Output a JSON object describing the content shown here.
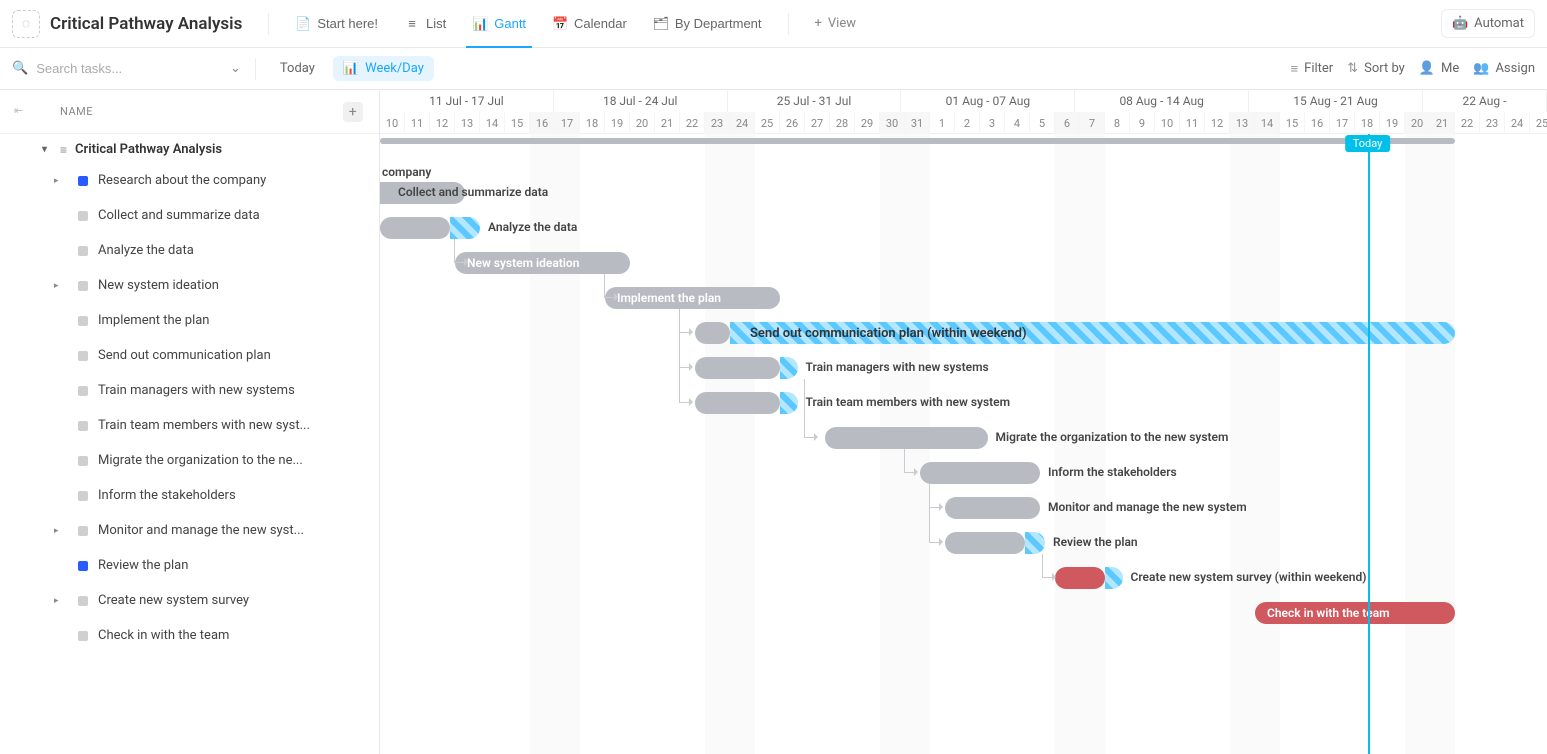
{
  "header": {
    "title": "Critical Pathway Analysis",
    "views": [
      {
        "label": "Start here!",
        "icon": "note-icon"
      },
      {
        "label": "List",
        "icon": "list-icon"
      },
      {
        "label": "Gantt",
        "icon": "gantt-icon",
        "active": true
      },
      {
        "label": "Calendar",
        "icon": "calendar-icon"
      },
      {
        "label": "By Department",
        "icon": "dept-icon"
      }
    ],
    "add_view_label": "View",
    "automate_label": "Automat"
  },
  "toolbar": {
    "search_placeholder": "Search tasks...",
    "today_label": "Today",
    "zoom_label": "Week/Day",
    "filter_label": "Filter",
    "sort_label": "Sort by",
    "me_label": "Me",
    "assign_label": "Assign"
  },
  "sidebar": {
    "column_header": "NAME",
    "group_title": "Critical Pathway Analysis",
    "tasks": [
      {
        "label": "Research about the company",
        "status": "blue",
        "has_children": true
      },
      {
        "label": "Collect and summarize data",
        "status": "grey"
      },
      {
        "label": "Analyze the data",
        "status": "grey"
      },
      {
        "label": "New system ideation",
        "status": "grey",
        "has_children": true
      },
      {
        "label": "Implement the plan",
        "status": "grey"
      },
      {
        "label": "Send out communication plan",
        "status": "grey"
      },
      {
        "label": "Train managers with new systems",
        "status": "grey"
      },
      {
        "label": "Train team members with new syst...",
        "status": "grey"
      },
      {
        "label": "Migrate the organization to the ne...",
        "status": "grey"
      },
      {
        "label": "Inform the stakeholders",
        "status": "grey"
      },
      {
        "label": "Monitor and manage the new syst...",
        "status": "grey",
        "has_children": true
      },
      {
        "label": "Review the plan",
        "status": "blue"
      },
      {
        "label": "Create new system survey",
        "status": "grey",
        "has_children": true
      },
      {
        "label": "Check in with the team",
        "status": "grey"
      }
    ]
  },
  "gantt": {
    "today_label": "Today",
    "today_day_index": 39,
    "day_width": 25,
    "weeks": [
      {
        "label": "11 Jul - 17 Jul",
        "days": 7
      },
      {
        "label": "18 Jul - 24 Jul",
        "days": 7
      },
      {
        "label": "25 Jul - 31 Jul",
        "days": 7
      },
      {
        "label": "01 Aug - 07 Aug",
        "days": 7
      },
      {
        "label": "08 Aug - 14 Aug",
        "days": 7
      },
      {
        "label": "15 Aug - 21 Aug",
        "days": 7
      },
      {
        "label": "22 Aug -",
        "days": 5
      }
    ],
    "days": [
      "10",
      "11",
      "12",
      "13",
      "14",
      "15",
      "16",
      "17",
      "18",
      "19",
      "20",
      "21",
      "22",
      "23",
      "24",
      "25",
      "26",
      "27",
      "28",
      "29",
      "30",
      "31",
      "1",
      "2",
      "3",
      "4",
      "5",
      "6",
      "7",
      "8",
      "9",
      "10",
      "11",
      "12",
      "13",
      "14",
      "15",
      "16",
      "17",
      "18",
      "19",
      "20",
      "21",
      "22",
      "23",
      "24",
      "25"
    ],
    "shaded_days": [
      6,
      7,
      13,
      14,
      20,
      21,
      27,
      28,
      34,
      35,
      41,
      42
    ],
    "summary_start": 0,
    "summary_end": 43,
    "first_row_label": "company",
    "bars": [
      {
        "row": 1,
        "start": -11,
        "end": 0.4,
        "kind": "grey",
        "label": "Collect and summarize data",
        "label_out": true
      },
      {
        "row": 2,
        "start": 0,
        "end": 2.8,
        "kind": "grey",
        "ext_to": 4,
        "label": "Analyze the data",
        "label_out": true
      },
      {
        "row": 3,
        "start": 3,
        "end": 10,
        "kind": "grey",
        "label": "New system ideation",
        "label_in": true
      },
      {
        "row": 4,
        "start": 9,
        "end": 16,
        "kind": "grey",
        "label": "Implement the plan",
        "label_in": true
      },
      {
        "row": 5,
        "start": 12.6,
        "end": 14,
        "kind": "grey",
        "ext_to": 43,
        "label": "Send out communication plan (within weekend)",
        "label_ext_in": true
      },
      {
        "row": 6,
        "start": 12.6,
        "end": 16,
        "kind": "grey",
        "ext_to": 16.7,
        "label": "Train managers with new systems",
        "label_out": true
      },
      {
        "row": 7,
        "start": 12.6,
        "end": 16,
        "kind": "grey",
        "ext_to": 16.7,
        "label": "Train team members with new system",
        "label_out": true
      },
      {
        "row": 8,
        "start": 17.8,
        "end": 24.3,
        "kind": "grey",
        "label": "Migrate the organization to the new system",
        "label_out": true
      },
      {
        "row": 9,
        "start": 21.6,
        "end": 26.4,
        "kind": "grey",
        "label": "Inform the stakeholders",
        "label_out": true
      },
      {
        "row": 10,
        "start": 22.6,
        "end": 26.4,
        "kind": "grey",
        "label": "Monitor and manage the new system",
        "label_out": true
      },
      {
        "row": 11,
        "start": 22.6,
        "end": 25.8,
        "kind": "grey",
        "ext_to": 26.6,
        "label": "Review the plan",
        "label_out": true
      },
      {
        "row": 12,
        "start": 27,
        "end": 29,
        "kind": "red",
        "ext_to": 29.7,
        "label": "Create new system survey (within weekend)",
        "label_out": true
      },
      {
        "row": 13,
        "start": 35,
        "end": 43,
        "kind": "red",
        "label": "Check in with the team",
        "label_in": true
      }
    ],
    "deps": [
      {
        "from_row": 2,
        "to_row": 3,
        "x": 3.2
      },
      {
        "from_row": 3,
        "to_row": 4,
        "x": 9.2
      },
      {
        "from_row": 4,
        "to_row": 5,
        "x": 12.2
      },
      {
        "from_row": 4,
        "to_row": 6,
        "x": 12.2
      },
      {
        "from_row": 4,
        "to_row": 7,
        "x": 12.2
      },
      {
        "from_row": 6,
        "to_row": 8,
        "x": 17.2
      },
      {
        "from_row": 8,
        "to_row": 9,
        "x": 21.2
      },
      {
        "from_row": 9,
        "to_row": 10,
        "x": 22.2
      },
      {
        "from_row": 9,
        "to_row": 11,
        "x": 22.2
      },
      {
        "from_row": 11,
        "to_row": 12,
        "x": 26.7
      }
    ]
  }
}
